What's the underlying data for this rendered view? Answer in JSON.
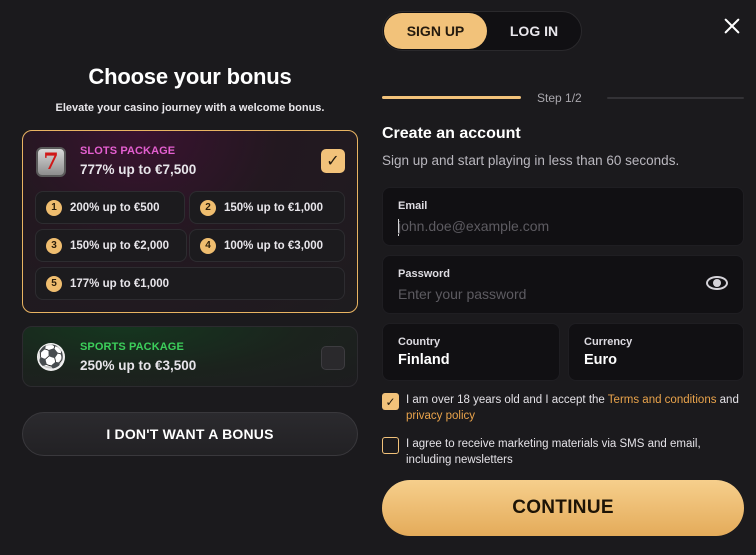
{
  "bonus": {
    "title": "Choose your bonus",
    "subtitle": "Elevate your casino journey with a welcome bonus.",
    "slots": {
      "name": "SLOTS PACKAGE",
      "amount": "777% up to €7,500",
      "icon": "slot-machine-icon",
      "selected": true,
      "tiers": [
        {
          "num": "1",
          "text": "200% up to €500"
        },
        {
          "num": "2",
          "text": "150% up to €1,000"
        },
        {
          "num": "3",
          "text": "150% up to €2,000"
        },
        {
          "num": "4",
          "text": "100% up to €3,000"
        },
        {
          "num": "5",
          "text": "177% up to €1,000"
        }
      ]
    },
    "sports": {
      "name": "SPORTS PACKAGE",
      "amount": "250% up to €3,500",
      "icon": "soccer-ball-icon",
      "selected": false
    },
    "no_bonus_label": "I DON'T WANT A BONUS"
  },
  "auth": {
    "tabs": {
      "signup": "SIGN UP",
      "login": "LOG IN",
      "active": "signup"
    },
    "step": "Step 1/2",
    "title": "Create an account",
    "subtitle": "Sign up and start playing in less than 60 seconds.",
    "email": {
      "label": "Email",
      "placeholder": "john.doe@example.com",
      "value": ""
    },
    "password": {
      "label": "Password",
      "placeholder": "Enter your password",
      "value": ""
    },
    "country": {
      "label": "Country",
      "value": "Finland"
    },
    "currency": {
      "label": "Currency",
      "value": "Euro"
    },
    "terms": {
      "checked": true,
      "text_before": "I am over 18 years old and I accept the ",
      "link1": "Terms and conditions",
      "text_middle": " and ",
      "link2": "privacy policy"
    },
    "marketing": {
      "checked": false,
      "text": "I agree to receive marketing materials via SMS and email, including newsletters"
    },
    "continue_label": "CONTINUE"
  },
  "colors": {
    "accent": "#f2c27a",
    "slots_name": "#e45fd0",
    "sports_name": "#3ccf5b",
    "link": "#e9a34b",
    "background": "#1b1a1d"
  }
}
